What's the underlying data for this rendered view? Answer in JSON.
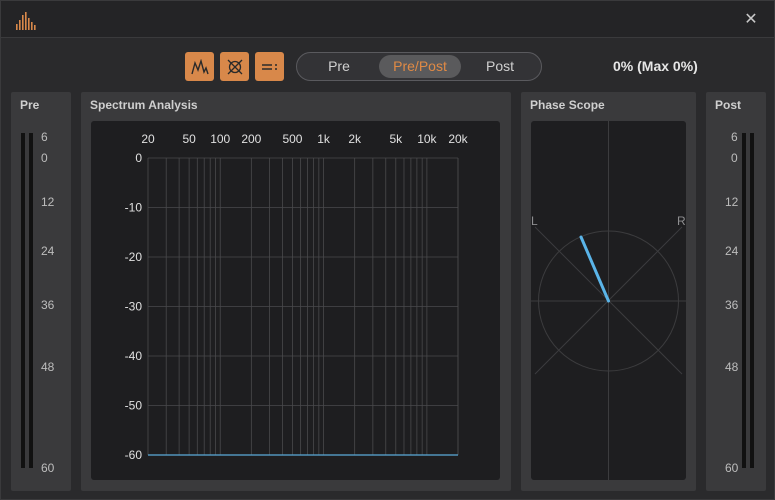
{
  "titlebar": {
    "close_symbol": "✕"
  },
  "toolbar": {
    "buttons": [
      {
        "name": "spectrum-view-icon"
      },
      {
        "name": "phase-view-icon"
      },
      {
        "name": "meters-view-icon"
      }
    ],
    "modes": [
      "Pre",
      "Pre/Post",
      "Post"
    ],
    "active_mode": "Pre/Post",
    "readout": "0% (Max 0%)"
  },
  "pre_meter": {
    "title": "Pre",
    "labels": [
      "6",
      "0",
      "12",
      "24",
      "36",
      "48",
      "60"
    ]
  },
  "post_meter": {
    "title": "Post",
    "labels": [
      "6",
      "0",
      "12",
      "24",
      "36",
      "48",
      "60"
    ]
  },
  "spectrum": {
    "title": "Spectrum Analysis",
    "x_ticks": [
      "20",
      "50",
      "100",
      "200",
      "500",
      "1k",
      "2k",
      "5k",
      "10k",
      "20k"
    ],
    "y_ticks": [
      "0",
      "-10",
      "-20",
      "-30",
      "-40",
      "-50",
      "-60"
    ]
  },
  "phase": {
    "title": "Phase Scope",
    "left_label": "L",
    "right_label": "R"
  },
  "colors": {
    "accent": "#d8884a",
    "trace": "#5ab4e8"
  }
}
